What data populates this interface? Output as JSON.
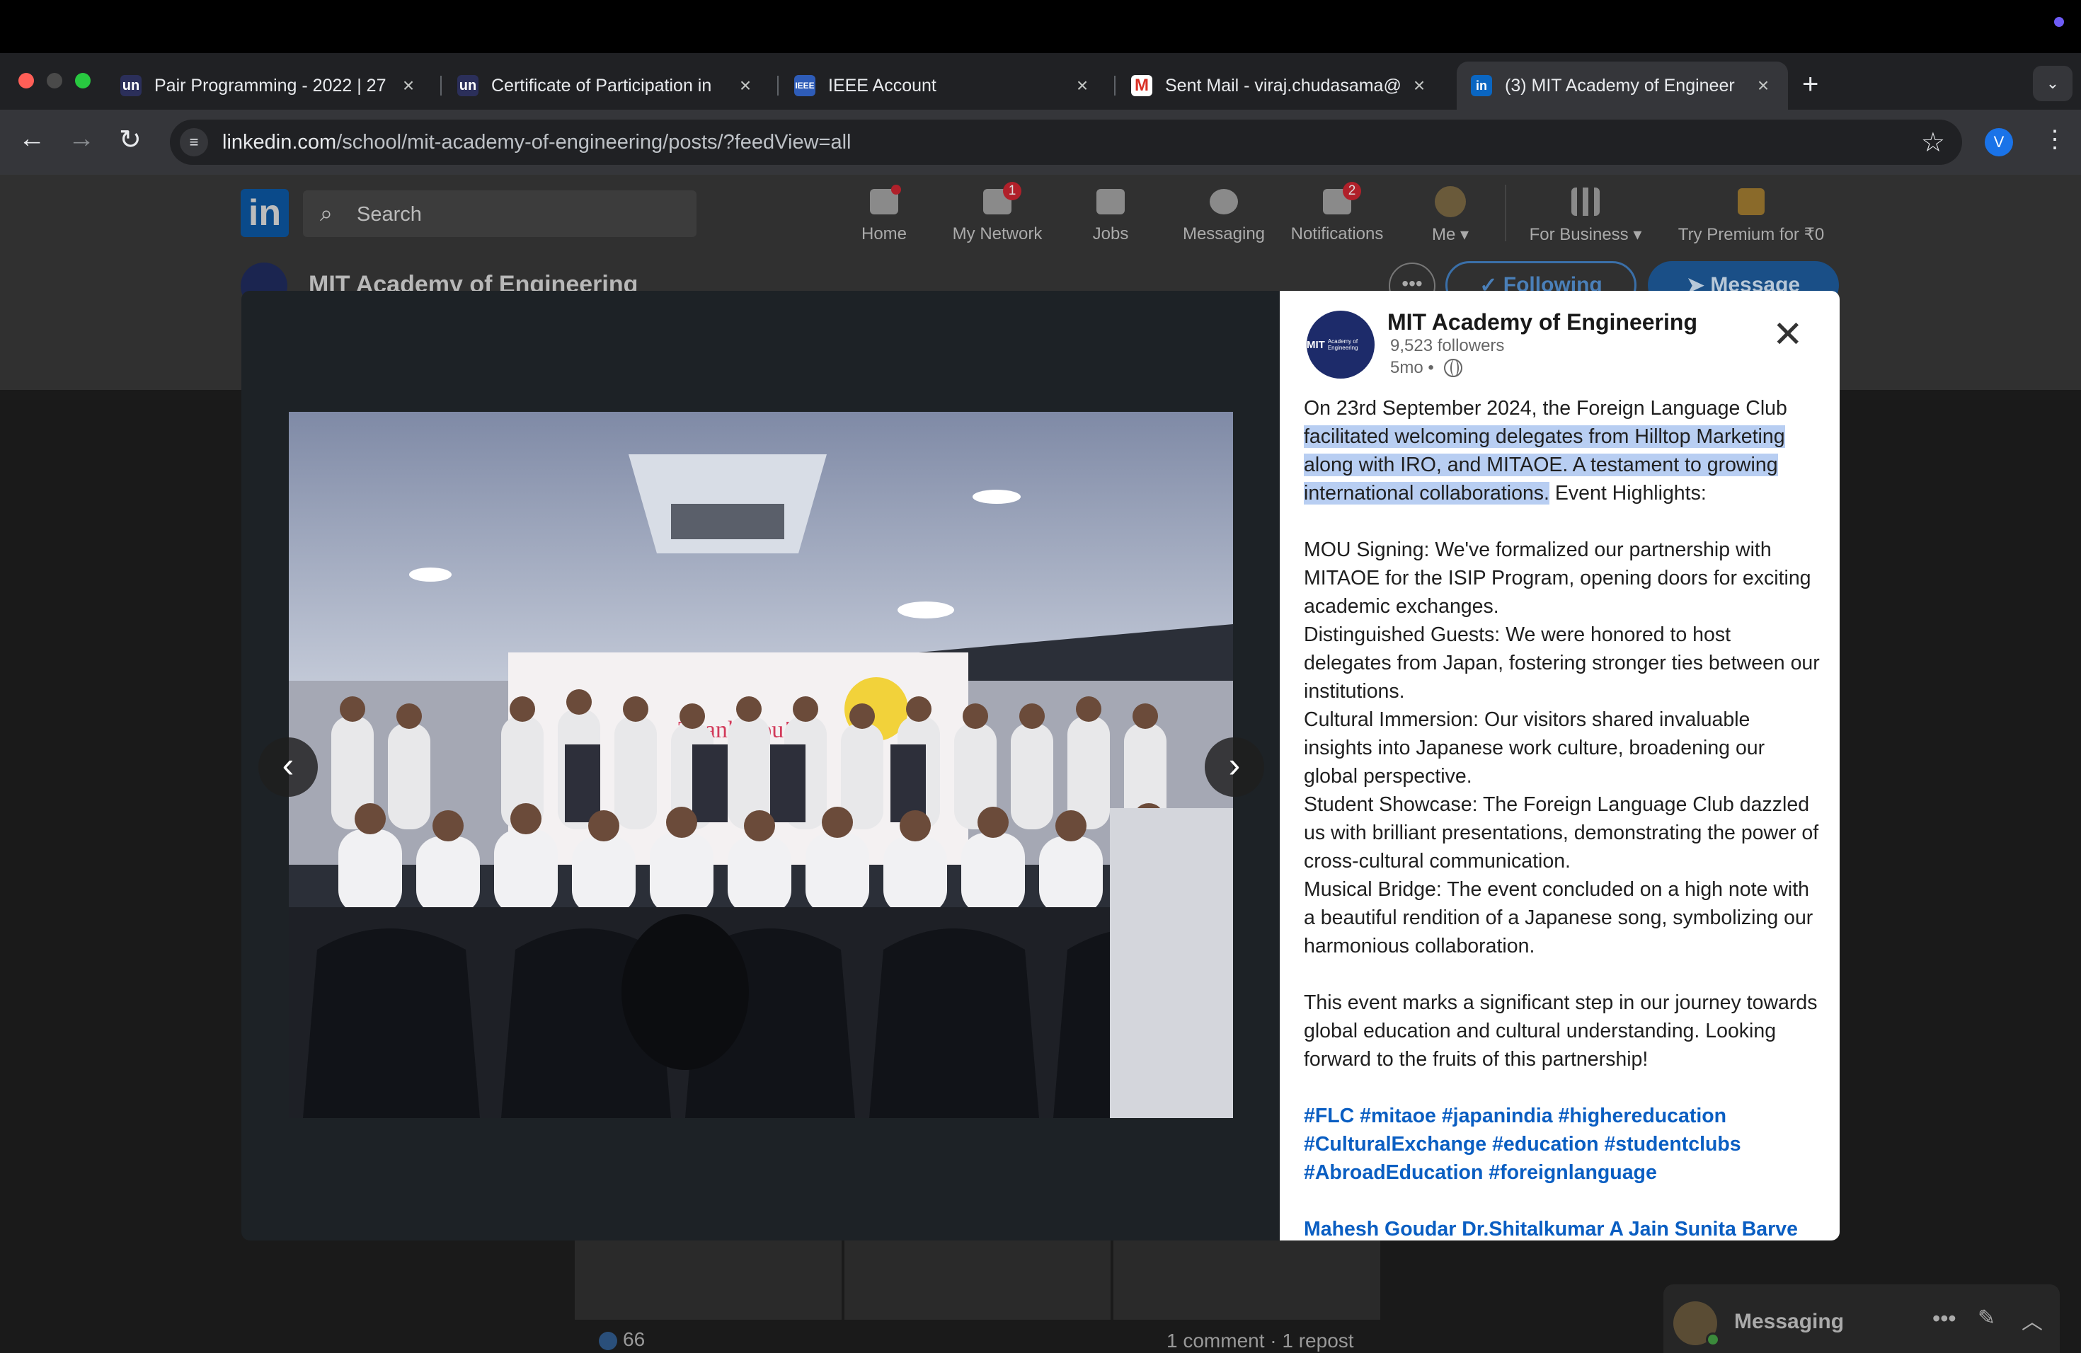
{
  "browser": {
    "tabs": [
      {
        "favicon": "un",
        "title": "Pair Programming - 2022 | 27"
      },
      {
        "favicon": "un",
        "title": "Certificate of Participation in"
      },
      {
        "favicon": "ieee",
        "title": "IEEE Account"
      },
      {
        "favicon": "gmail",
        "title": "Sent Mail - viraj.chudasama@"
      },
      {
        "favicon": "in",
        "title": "(3) MIT Academy of Engineer"
      }
    ],
    "url_host": "linkedin.com",
    "url_path": "/school/mit-academy-of-engineering/posts/?feedView=all",
    "profile_initial": "V"
  },
  "linkedin": {
    "search_placeholder": "Search",
    "nav": {
      "home": "Home",
      "network": "My Network",
      "network_badge": "1",
      "jobs": "Jobs",
      "messaging": "Messaging",
      "notifications": "Notifications",
      "notifications_badge": "2",
      "me": "Me",
      "business": "For Business",
      "premium": "Try Premium for ₹0"
    },
    "page_name": "MIT Academy of Engineering",
    "following_label": "Following",
    "message_label": "Message",
    "reactions_count": "66",
    "comments_reposts": "1 comment · 1 repost",
    "messaging_dock_label": "Messaging"
  },
  "modal": {
    "org_logo_text": "MIT",
    "org_logo_sub": "Academy of Engineering",
    "org_name": "MIT Academy of Engineering",
    "followers": "9,523 followers",
    "time": "5mo •",
    "post": {
      "intro_plain": "On 23rd September 2024, the Foreign Language Club ",
      "intro_highlight": "facilitated welcoming delegates from Hilltop Marketing along with IRO, and MITAOE. A testament to growing international collaborations.",
      "intro_tail": " Event Highlights:",
      "highlights": [
        "MOU Signing: We've formalized our partnership with MITAOE for the ISIP Program, opening doors for exciting academic exchanges.",
        "Distinguished Guests: We were honored to host delegates from Japan, fostering stronger ties between our institutions.",
        "Cultural Immersion: Our visitors shared invaluable insights into Japanese work culture, broadening our global perspective.",
        "Student Showcase: The Foreign Language Club dazzled us with brilliant presentations, demonstrating the power of cross-cultural communication.",
        "Musical Bridge: The event concluded on a high note with a beautiful rendition of a Japanese song, symbolizing our harmonious collaboration."
      ],
      "closing": "This event marks a significant step in our journey towards global education and cultural understanding. Looking forward to the fruits of this partnership!",
      "hashtags": [
        "#FLC",
        "#mitaoe",
        "#japanindia",
        "#highereducation",
        "#CulturalExchange",
        "#education",
        "#studentclubs",
        "#AbroadEducation",
        "#foreignlanguage"
      ],
      "mentions": [
        "Mahesh Goudar",
        "Dr.Shitalkumar A Jain",
        "Sunita Barve"
      ]
    },
    "photo_screen_text": "Thank You!"
  },
  "colors": {
    "linkedin_blue": "#0a66c2",
    "highlight": "#b8cef2",
    "notification_red": "#cc1016"
  }
}
